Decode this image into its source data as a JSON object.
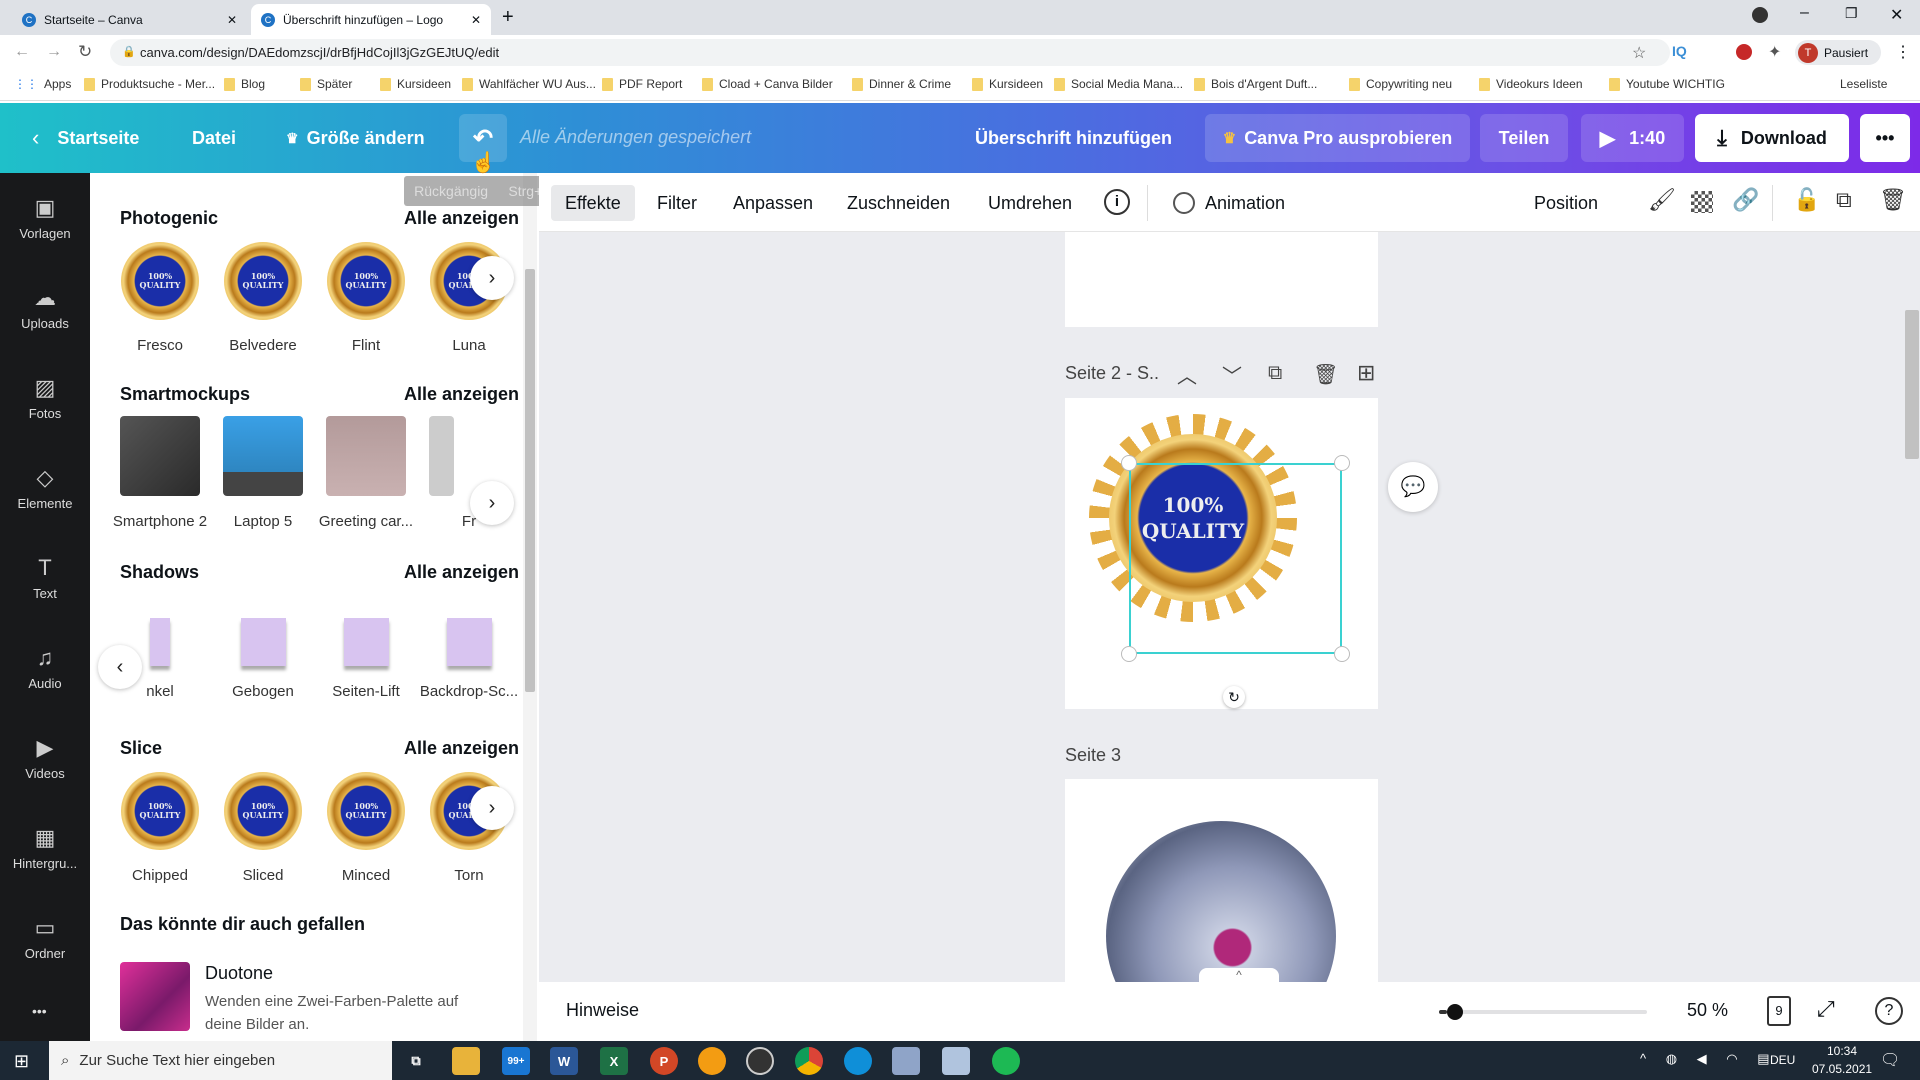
{
  "browser": {
    "tabs": [
      {
        "title": "Startseite – Canva",
        "active": false
      },
      {
        "title": "Überschrift hinzufügen – Logo",
        "active": true
      }
    ],
    "url": "canva.com/design/DAEdomzscjI/drBfjHdCojIl3jGzGEJtUQ/edit",
    "profile": "Pausiert",
    "bookmarks": [
      "Apps",
      "Produktsuche - Mer...",
      "Blog",
      "Später",
      "Kursideen",
      "Wahlfächer WU Aus...",
      "PDF Report",
      "Cload + Canva Bilder",
      "Dinner & Crime",
      "Kursideen",
      "Social Media Mana...",
      "Bois d'Argent Duft...",
      "Copywriting neu",
      "Videokurs Ideen",
      "Youtube WICHTIG"
    ],
    "reading_list": "Leseliste"
  },
  "header": {
    "home": "Startseite",
    "file": "Datei",
    "resize": "Größe ändern",
    "saved_status": "Alle Änderungen gespeichert",
    "title": "Überschrift hinzufügen",
    "pro": "Canva Pro ausprobieren",
    "share": "Teilen",
    "present": "1:40",
    "download": "Download",
    "more": "•••"
  },
  "tooltip": {
    "label": "Rückgängig",
    "shortcut": "Strg+Z"
  },
  "sidebar": {
    "items": [
      {
        "label": "Vorlagen",
        "icon": "template-icon"
      },
      {
        "label": "Uploads",
        "icon": "upload-icon"
      },
      {
        "label": "Fotos",
        "icon": "photo-icon"
      },
      {
        "label": "Elemente",
        "icon": "elements-icon"
      },
      {
        "label": "Text",
        "icon": "text-icon"
      },
      {
        "label": "Audio",
        "icon": "audio-icon"
      },
      {
        "label": "Videos",
        "icon": "video-icon"
      },
      {
        "label": "Hintergru...",
        "icon": "background-icon"
      },
      {
        "label": "Ordner",
        "icon": "folder-icon"
      }
    ],
    "more": "•••"
  },
  "panel": {
    "see_all": "Alle anzeigen",
    "sections": [
      {
        "title": "Photogenic",
        "items": [
          "Fresco",
          "Belvedere",
          "Flint",
          "Luna"
        ]
      },
      {
        "title": "Smartmockups",
        "items": [
          "Smartphone 2",
          "Laptop 5",
          "Greeting car...",
          "Fr"
        ]
      },
      {
        "title": "Shadows",
        "items": [
          "nkel",
          "Gebogen",
          "Seiten-Lift",
          "Backdrop-Sc..."
        ]
      },
      {
        "title": "Slice",
        "items": [
          "Chipped",
          "Sliced",
          "Minced",
          "Torn"
        ]
      }
    ],
    "badge_text": [
      "100%",
      "QUALITY"
    ],
    "suggest_title": "Das könnte dir auch gefallen",
    "suggest": {
      "title": "Duotone",
      "desc": "Wenden eine Zwei-Farben-Palette auf deine Bilder an."
    }
  },
  "toolbar": {
    "items": [
      "Effekte",
      "Filter",
      "Anpassen",
      "Zuschneiden",
      "Umdrehen"
    ],
    "animation": "Animation",
    "position": "Position"
  },
  "canvas": {
    "page2_label": "Seite 2 - S..",
    "page3_label": "Seite 3",
    "badge_text": [
      "100%",
      "QUALITY"
    ],
    "selection_color": "#3ad1d1"
  },
  "bottom": {
    "notes": "Hinweise",
    "zoom": "50 %",
    "zoom_value": 50,
    "page_count": "9"
  },
  "taskbar": {
    "search": "Zur Suche Text hier eingeben",
    "mail_badge": "99+",
    "lang": "DEU",
    "time": "10:34",
    "date": "07.05.2021"
  },
  "colors": {
    "header_start": "#1fc0c9",
    "header_end": "#7d2ae8",
    "sidebar": "#18191b",
    "canvas_bg": "#ebecf0"
  }
}
